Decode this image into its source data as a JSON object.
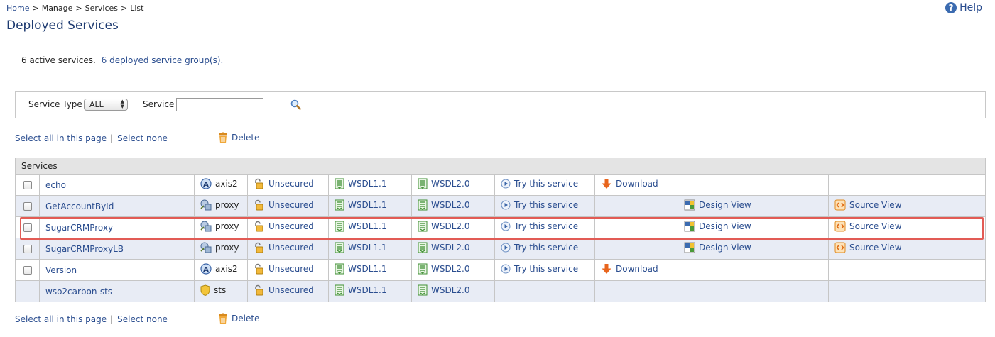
{
  "breadcrumb": {
    "home": "Home",
    "manage": "Manage",
    "services": "Services",
    "list": "List",
    "sep": ">"
  },
  "page_title": "Deployed Services",
  "help_label": "Help",
  "summary": {
    "active": "6 active services.",
    "groups": "6 deployed service group(s)."
  },
  "filter": {
    "type_label": "Service Type",
    "type_value": "ALL",
    "service_label": "Service",
    "service_value": ""
  },
  "actions": {
    "select_all": "Select all in this page",
    "separator": "|",
    "select_none": "Select none",
    "delete": "Delete"
  },
  "table": {
    "header": "Services",
    "rows": [
      {
        "name": "echo",
        "type": "axis2",
        "security": "Unsecured",
        "wsdl11": "WSDL1.1",
        "wsdl20": "WSDL2.0",
        "try": "Try this service",
        "download": "Download",
        "design": "",
        "source": ""
      },
      {
        "name": "GetAccountById",
        "type": "proxy",
        "security": "Unsecured",
        "wsdl11": "WSDL1.1",
        "wsdl20": "WSDL2.0",
        "try": "Try this service",
        "download": "",
        "design": "Design View",
        "source": "Source View"
      },
      {
        "name": "SugarCRMProxy",
        "type": "proxy",
        "security": "Unsecured",
        "wsdl11": "WSDL1.1",
        "wsdl20": "WSDL2.0",
        "try": "Try this service",
        "download": "",
        "design": "Design View",
        "source": "Source View"
      },
      {
        "name": "SugarCRMProxyLB",
        "type": "proxy",
        "security": "Unsecured",
        "wsdl11": "WSDL1.1",
        "wsdl20": "WSDL2.0",
        "try": "Try this service",
        "download": "",
        "design": "Design View",
        "source": "Source View"
      },
      {
        "name": "Version",
        "type": "axis2",
        "security": "Unsecured",
        "wsdl11": "WSDL1.1",
        "wsdl20": "WSDL2.0",
        "try": "Try this service",
        "download": "Download",
        "design": "",
        "source": ""
      },
      {
        "name": "wso2carbon-sts",
        "type": "sts",
        "security": "Unsecured",
        "wsdl11": "WSDL1.1",
        "wsdl20": "WSDL2.0",
        "try": "",
        "download": "",
        "design": "",
        "source": ""
      }
    ]
  },
  "icons": {
    "type_axis2": "axis2-service-icon",
    "type_proxy": "proxy-service-icon",
    "type_sts": "sts-shield-icon",
    "security": "unlocked-padlock-icon",
    "wsdl": "wsdl-document-icon",
    "try": "play-circle-icon",
    "download": "download-arrow-icon",
    "design": "design-view-icon",
    "source": "source-view-icon",
    "delete": "trash-icon",
    "search": "magnifier-icon",
    "help": "help-question-icon"
  },
  "colors": {
    "link": "#2a4d8f",
    "title": "#1d3a70",
    "row_alt": "#e8ecf5",
    "highlight": "#e25b55",
    "download": "#e8651d"
  }
}
